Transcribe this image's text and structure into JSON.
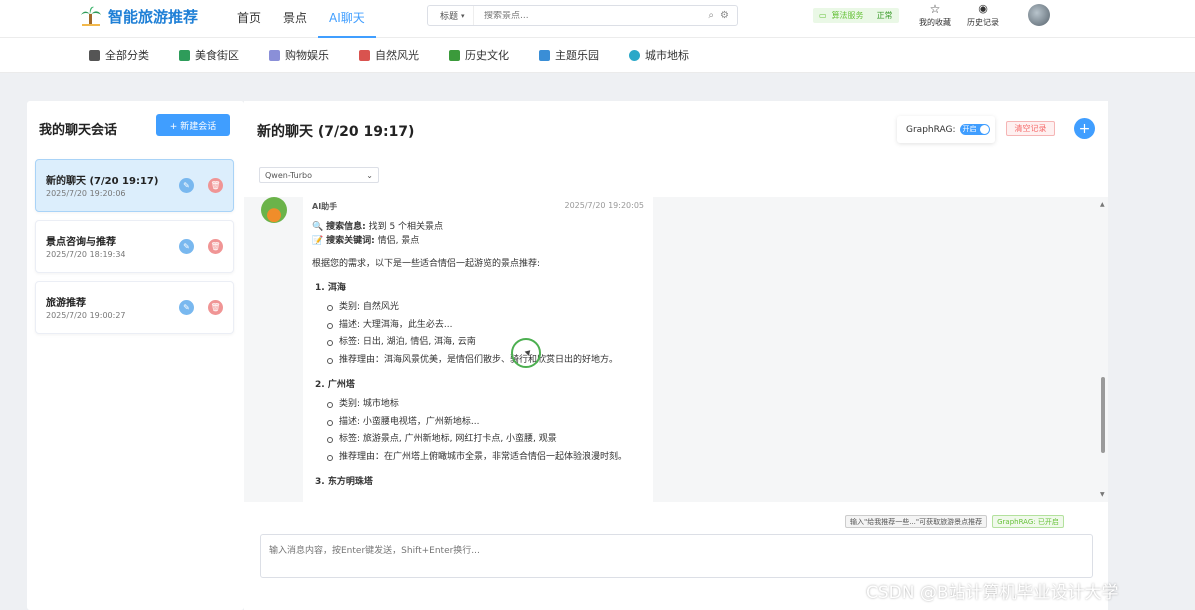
{
  "app": {
    "title": "智能旅游推荐"
  },
  "nav": {
    "items": [
      {
        "label": "首页"
      },
      {
        "label": "景点"
      },
      {
        "label": "AI聊天"
      }
    ]
  },
  "search": {
    "type": "标题",
    "placeholder": "搜索景点..."
  },
  "status": {
    "label": "算法服务",
    "value": "正常"
  },
  "top_actions": {
    "favorites": "我的收藏",
    "history": "历史记录"
  },
  "categories": [
    {
      "label": "全部分类",
      "color": "#555555"
    },
    {
      "label": "美食街区",
      "color": "#2e9c5a"
    },
    {
      "label": "购物娱乐",
      "color": "#8a8fd8"
    },
    {
      "label": "自然风光",
      "color": "#d9534f"
    },
    {
      "label": "历史文化",
      "color": "#3b9a3b"
    },
    {
      "label": "主题乐园",
      "color": "#3a8ed6"
    },
    {
      "label": "城市地标",
      "color": "#2ba8c8"
    }
  ],
  "sidebar": {
    "title": "我的聊天会话",
    "new_button": "+ 新建会话",
    "sessions": [
      {
        "title": "新的聊天 (7/20 19:17)",
        "time": "2025/7/20 19:20:06"
      },
      {
        "title": "景点咨询与推荐",
        "time": "2025/7/20 18:19:34"
      },
      {
        "title": "旅游推荐",
        "time": "2025/7/20 19:00:27"
      }
    ]
  },
  "chat": {
    "title": "新的聊天 (7/20 19:17)",
    "graphrag_label": "GraphRAG:",
    "graphrag_toggle": "开启",
    "clear_button": "清空记录",
    "model": "Qwen-Turbo",
    "message": {
      "sender": "AI助手",
      "time": "2025/7/20 19:20:05",
      "search_info_label": "搜索信息:",
      "search_info_value": "找到 5 个相关景点",
      "keywords_label": "搜索关键词:",
      "keywords_value": "情侣, 景点",
      "intro": "根据您的需求，以下是一些适合情侣一起游览的景点推荐:",
      "items": [
        {
          "title": "1. 洱海",
          "details": [
            "类别: 自然风光",
            "描述: 大理洱海，此生必去...",
            "标签: 日出, 湖泊, 情侣, 洱海, 云南",
            "推荐理由：洱海风景优美，是情侣们散步、骑行和欣赏日出的好地方。"
          ]
        },
        {
          "title": "2. 广州塔",
          "details": [
            "类别: 城市地标",
            "描述: 小蛮腰电视塔，广州新地标...",
            "标签: 旅游景点, 广州新地标, 网红打卡点, 小蛮腰, 观景",
            "推荐理由：在广州塔上俯瞰城市全景，非常适合情侣一起体验浪漫时刻。"
          ]
        },
        {
          "title": "3. 东方明珠塔",
          "details": []
        }
      ]
    },
    "hint": "输入\"给我推荐一些...\"可获取旅游景点推荐",
    "graphrag_status": "GraphRAG: 已开启",
    "input_placeholder": "输入消息内容，按Enter键发送，Shift+Enter换行..."
  },
  "watermark": "CSDN @B站计算机毕业设计大学"
}
